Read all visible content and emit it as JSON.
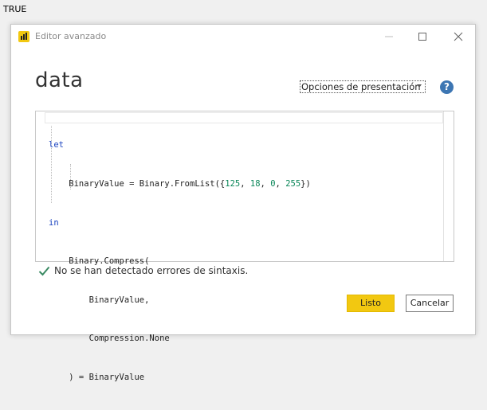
{
  "outer_label": "TRUE",
  "window": {
    "title": "Editor avanzado",
    "controls": {
      "minimize_icon": "minimize-icon",
      "maximize_icon": "maximize-icon",
      "close_icon": "close-icon"
    }
  },
  "query_name": "data",
  "view_options": {
    "label": "Opciones de presentación"
  },
  "help": {
    "glyph": "?"
  },
  "code": {
    "lines": [
      "let",
      "    BinaryValue = Binary.FromList({125, 18, 0, 255})",
      "in",
      "    Binary.Compress(",
      "        BinaryValue,",
      "        Compression.None",
      "    ) = BinaryValue"
    ]
  },
  "status": {
    "text": "No se han detectado errores de sintaxis."
  },
  "buttons": {
    "done": "Listo",
    "cancel": "Cancelar"
  },
  "colors": {
    "accent": "#f2c811",
    "help": "#3d76b3",
    "check": "#3a8a63",
    "keyword": "#1a43c0",
    "number": "#098658"
  }
}
